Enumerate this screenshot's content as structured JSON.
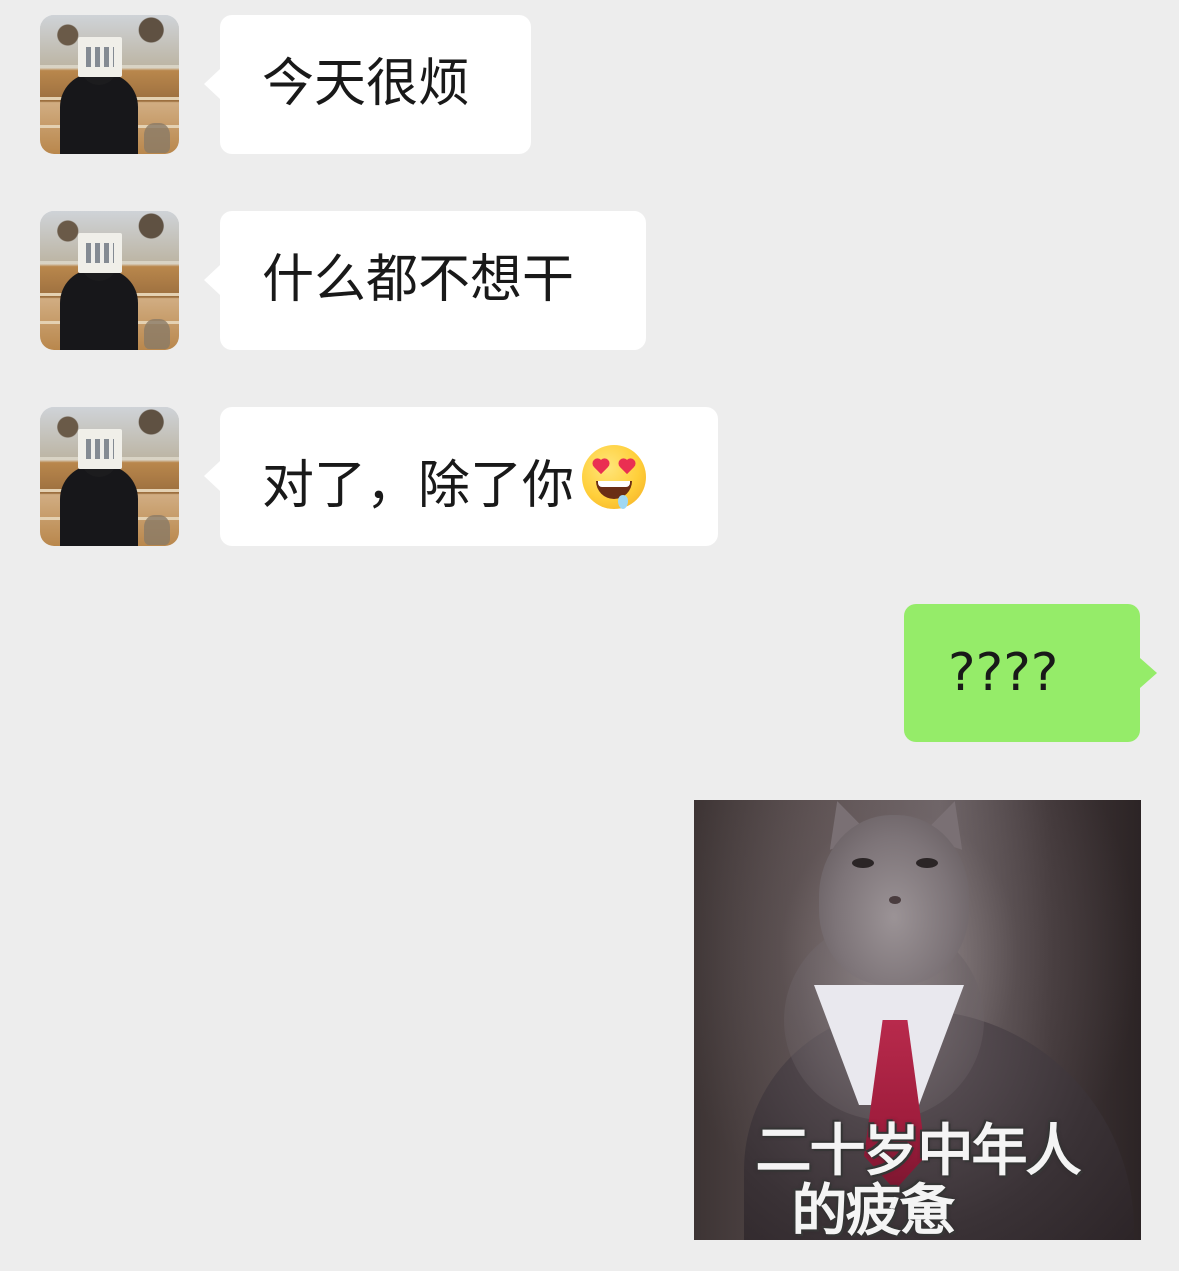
{
  "chat": {
    "messages": [
      {
        "sender": "other",
        "text": "今天很烦"
      },
      {
        "sender": "other",
        "text": "什么都不想干"
      },
      {
        "sender": "other",
        "text": "对了，除了你",
        "emoji": "star-struck-drooling-emoji"
      },
      {
        "sender": "me",
        "text": "????"
      },
      {
        "sender": "me",
        "type": "sticker",
        "sticker_caption_line1": "二十岁中年人",
        "sticker_caption_line2": "的疲惫"
      }
    ]
  },
  "colors": {
    "background": "#ededed",
    "incoming_bubble": "#ffffff",
    "outgoing_bubble": "#95ec69",
    "text": "#191919"
  }
}
